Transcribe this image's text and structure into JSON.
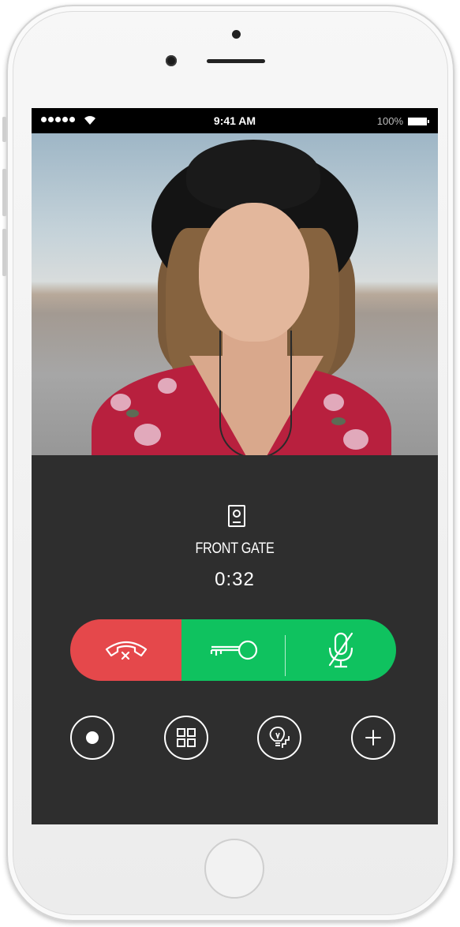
{
  "status_bar": {
    "time": "9:41 AM",
    "battery": "100%"
  },
  "call": {
    "location_label": "FRONT GATE",
    "elapsed": "0:32"
  },
  "colors": {
    "hangup": "#e5484b",
    "accept": "#0fc25f",
    "panel": "#2e2e2e"
  },
  "icons": {
    "hangup": "hang-up-phone-icon",
    "door": "key-icon",
    "mic": "mic-muted-icon",
    "record": "record-icon",
    "grid": "grid-icon",
    "light": "light-stairs-icon",
    "add": "plus-icon",
    "location": "door-station-icon"
  }
}
